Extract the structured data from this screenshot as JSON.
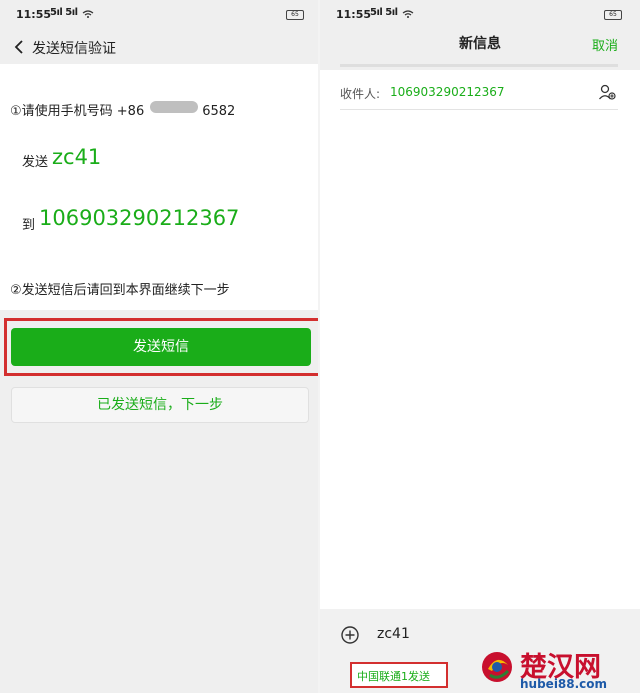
{
  "left": {
    "status": {
      "time": "11:55",
      "signal": "5ıl 5ıl",
      "battery": "65"
    },
    "title": "发送短信验证",
    "step1_text": "①请使用手机号码 +86",
    "step1_suffix": "6582",
    "send_label": "发送",
    "send_code": "zc41",
    "to_label": "到",
    "to_number": "106903290212367",
    "step2_text": "②发送短信后请回到本界面继续下一步",
    "send_button": "发送短信",
    "sent_next_button": "已发送短信，下一步"
  },
  "right": {
    "status": {
      "time": "11:55",
      "signal": "5ıl 5ıl",
      "battery": "65"
    },
    "title": "新信息",
    "cancel": "取消",
    "recipient_label": "收件人:",
    "recipient_value": "106903290212367",
    "compose_text": "zc41",
    "send_via": "中国联通1发送"
  },
  "watermark": {
    "brand": "楚汉网",
    "domain": "hubei88.com"
  },
  "colors": {
    "accent": "#1aad19",
    "highlight": "#d32f2f",
    "watermark": "#c8102e"
  }
}
